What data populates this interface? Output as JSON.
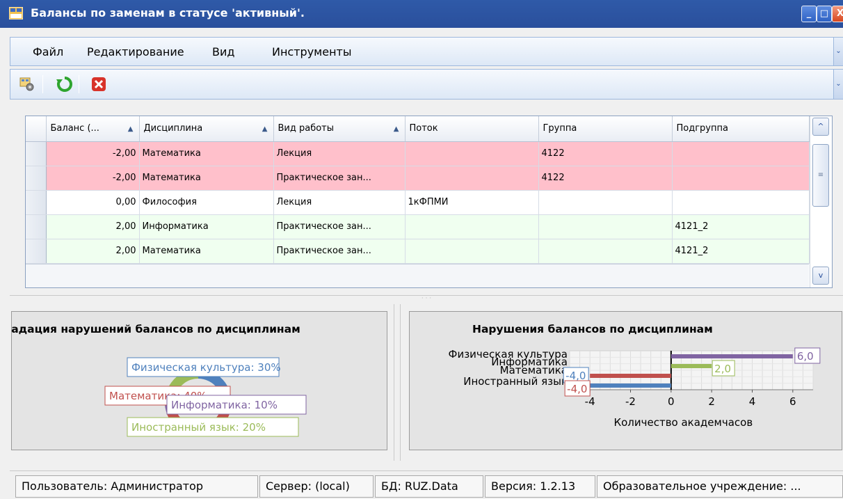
{
  "window": {
    "title": "Балансы по заменам в статусе 'активный'.",
    "min_glyph": "_",
    "max_glyph": "□",
    "close_glyph": "X"
  },
  "menu": {
    "items": [
      "Файл",
      "Редактирование",
      "Вид",
      "Инструменты"
    ],
    "chevron": "⌄"
  },
  "toolbar": {
    "buttons": [
      "settings-icon",
      "refresh-icon",
      "close-red-icon"
    ],
    "chevron": "⌄"
  },
  "grid": {
    "columns": [
      "Баланс (...",
      "Дисциплина",
      "Вид работы",
      "Поток",
      "Группа",
      "Подгруппа"
    ],
    "sort_glyph": "▲",
    "rows": [
      {
        "status": "neg",
        "cells": [
          "-2,00",
          "Математика",
          "Лекция",
          "",
          "4122",
          ""
        ]
      },
      {
        "status": "neg",
        "cells": [
          "-2,00",
          "Математика",
          "Практическое зан...",
          "",
          "4122",
          ""
        ]
      },
      {
        "status": "zero",
        "cells": [
          "0,00",
          "Философия",
          "Лекция",
          "1кФПМИ",
          "",
          ""
        ]
      },
      {
        "status": "pos",
        "cells": [
          "2,00",
          "Информатика",
          "Практическое зан...",
          "",
          "",
          "4121_2"
        ]
      },
      {
        "status": "pos",
        "cells": [
          "2,00",
          "Математика",
          "Практическое зан...",
          "",
          "",
          "4121_2"
        ]
      }
    ],
    "scroll_up": "^",
    "scroll_down": "v",
    "scroll_thumb": "≡"
  },
  "colors": {
    "negative_row": "#ffc0cb",
    "positive_row": "#f0fff0",
    "title_bar": "#2a4f9c"
  },
  "chart_data": [
    {
      "type": "pie",
      "title": "градация нарушений балансов по дисциплинам",
      "categories": [
        "Физическая культура",
        "Математика",
        "Информатика",
        "Иностранный язык"
      ],
      "values": [
        30,
        40,
        10,
        20
      ],
      "labels": [
        "Физическая культура: 30%",
        "Математика: 40%",
        "Информатика: 10%",
        "Иностранный язык: 20%"
      ],
      "colors": [
        "#4f81bd",
        "#c0504d",
        "#8064a2",
        "#9bbb59"
      ]
    },
    {
      "type": "bar",
      "orientation": "horizontal",
      "title": "Нарушения балансов по дисциплинам",
      "xlabel": "Количество академчасов",
      "ylabel": "",
      "categories": [
        "Физическая культура",
        "Информатика",
        "Математика",
        "Иностранный язык"
      ],
      "values": [
        6.0,
        2.0,
        -4.0,
        -4.0
      ],
      "data_labels": [
        "6,0",
        "2,0",
        "-4,0",
        "-4,0"
      ],
      "colors": [
        "#8064a2",
        "#9bbb59",
        "#c0504d",
        "#4f81bd"
      ],
      "xlim": [
        -5,
        7
      ],
      "xticks": [
        -4,
        -2,
        0,
        2,
        4,
        6
      ],
      "grid": true
    }
  ],
  "status": {
    "user": "Пользователь: Администратор",
    "server": "Сервер: (local)",
    "db": "БД: RUZ.Data",
    "version": "Версия: 1.2.13",
    "org": "Образовательное учреждение: ..."
  }
}
